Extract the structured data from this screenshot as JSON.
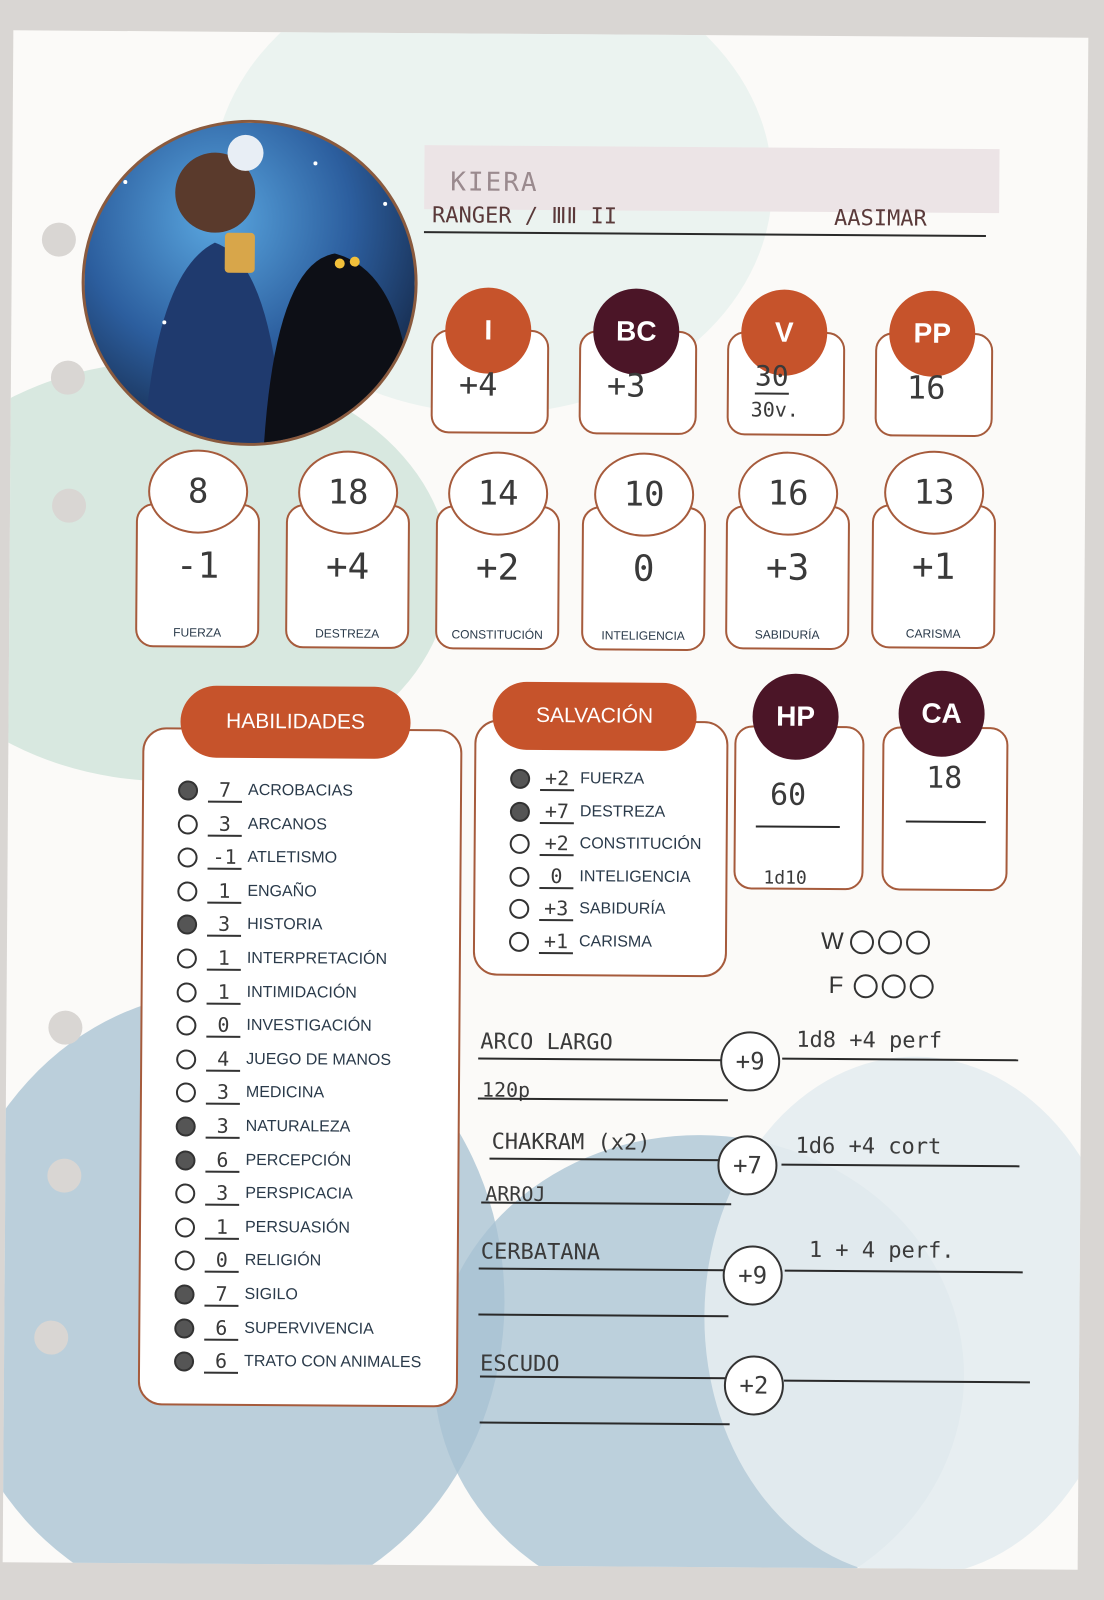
{
  "character": {
    "name": "KIERA",
    "class_level": "RANGER / ⅢⅡ II",
    "race": "AASIMAR"
  },
  "top_stats": [
    {
      "label": "I",
      "value": "+4",
      "color": "#c6532b"
    },
    {
      "label": "BC",
      "value": "+3",
      "color": "#4b1527"
    },
    {
      "label": "V",
      "value": "30",
      "value2": "30v.",
      "color": "#c6532b"
    },
    {
      "label": "PP",
      "value": "16",
      "color": "#c6532b"
    }
  ],
  "abilities": [
    {
      "label": "FUERZA",
      "score": "8",
      "mod": "-1"
    },
    {
      "label": "DESTREZA",
      "score": "18",
      "mod": "+4"
    },
    {
      "label": "CONSTITUCIÓN",
      "score": "14",
      "mod": "+2"
    },
    {
      "label": "INTELIGENCIA",
      "score": "10",
      "mod": "0"
    },
    {
      "label": "SABIDURÍA",
      "score": "16",
      "mod": "+3"
    },
    {
      "label": "CARISMA",
      "score": "13",
      "mod": "+1"
    }
  ],
  "skills_title": "HABILIDADES",
  "skills": [
    {
      "value": "7",
      "name": "ACROBACIAS",
      "prof": true
    },
    {
      "value": "3",
      "name": "ARCANOS",
      "prof": false
    },
    {
      "value": "-1",
      "name": "ATLETISMO",
      "prof": false
    },
    {
      "value": "1",
      "name": "ENGAÑO",
      "prof": false
    },
    {
      "value": "3",
      "name": "HISTORIA",
      "prof": true
    },
    {
      "value": "1",
      "name": "INTERPRETACIÓN",
      "prof": false
    },
    {
      "value": "1",
      "name": "INTIMIDACIÓN",
      "prof": false
    },
    {
      "value": "0",
      "name": "INVESTIGACIÓN",
      "prof": false
    },
    {
      "value": "4",
      "name": "JUEGO DE MANOS",
      "prof": false
    },
    {
      "value": "3",
      "name": "MEDICINA",
      "prof": false
    },
    {
      "value": "3",
      "name": "NATURALEZA",
      "prof": true
    },
    {
      "value": "6",
      "name": "PERCEPCIÓN",
      "prof": true
    },
    {
      "value": "3",
      "name": "PERSPICACIA",
      "prof": false
    },
    {
      "value": "1",
      "name": "PERSUASIÓN",
      "prof": false
    },
    {
      "value": "0",
      "name": "RELIGIÓN",
      "prof": false
    },
    {
      "value": "7",
      "name": "SIGILO",
      "prof": true
    },
    {
      "value": "6",
      "name": "SUPERVIVENCIA",
      "prof": true
    },
    {
      "value": "6",
      "name": "TRATO CON ANIMALES",
      "prof": true
    }
  ],
  "saves_title": "SALVACIÓN",
  "saves": [
    {
      "value": "+2",
      "name": "FUERZA",
      "prof": true
    },
    {
      "value": "+7",
      "name": "DESTREZA",
      "prof": true
    },
    {
      "value": "+2",
      "name": "CONSTITUCIÓN",
      "prof": false
    },
    {
      "value": "0",
      "name": "INTELIGENCIA",
      "prof": false
    },
    {
      "value": "+3",
      "name": "SABIDURÍA",
      "prof": false
    },
    {
      "value": "+1",
      "name": "CARISMA",
      "prof": false
    }
  ],
  "hp": {
    "label": "HP",
    "value": "60",
    "dice": "1d10"
  },
  "ca": {
    "label": "CA",
    "value": "18"
  },
  "death_saves": {
    "w": "W",
    "f": "F"
  },
  "weapons": [
    {
      "name": "ARCO LARGO",
      "note": "120p",
      "bonus": "+9",
      "damage": "1d8 +4 perf"
    },
    {
      "name": "CHAKRAM (x2)",
      "note": "ARROJ",
      "bonus": "+7",
      "damage": "1d6 +4 cort"
    },
    {
      "name": "CERBATANA",
      "note": "",
      "bonus": "+9",
      "damage": "1 + 4 perf."
    },
    {
      "name": "ESCUDO",
      "note": "",
      "bonus": "+2",
      "damage": ""
    }
  ]
}
